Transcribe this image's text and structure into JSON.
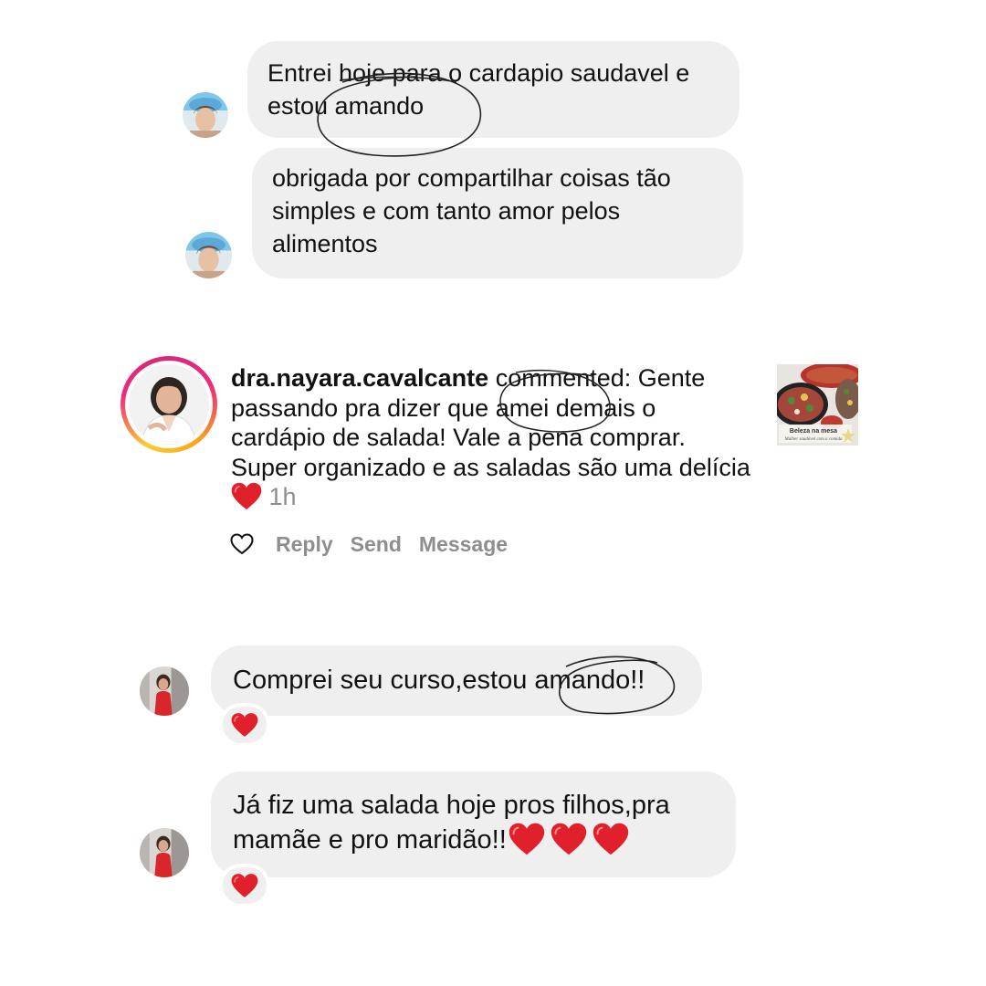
{
  "messages": [
    {
      "text": "Entrei hoje para o cardapio saudavel e estou amando"
    },
    {
      "text": "obrigada por compartilhar coisas tão simples e com tanto amor pelos alimentos"
    },
    {
      "text": "Comprei seu curso,estou amando!!",
      "reaction": "heart"
    },
    {
      "text": "Já fiz uma salada hoje pros filhos,pra mamãe e pro maridão!!",
      "reaction": "heart",
      "trailing_emoji_count": 3
    }
  ],
  "notification": {
    "username": "dra.nayara.cavalcante",
    "text": " commented: Gente passando pra dizer que amei demais o cardápio de salada! Vale a pena comprar. Super organizado e as saladas são uma delícia ",
    "time": "1h",
    "actions": {
      "reply": "Reply",
      "send": "Send",
      "message": "Message"
    },
    "post_thumbnail": {
      "title": "Beleza na mesa",
      "subtitle": "Mulher saudável com a comida"
    }
  },
  "icons": {
    "heart_outline": "heart-outline-icon",
    "heart_emoji": "red-heart-emoji"
  },
  "colors": {
    "bubble": "#efefef",
    "text": "#111111",
    "muted": "#8e8e8e",
    "heart": "#e0202b",
    "ring_start": "#f9ce34",
    "ring_mid": "#ee2a7b"
  }
}
